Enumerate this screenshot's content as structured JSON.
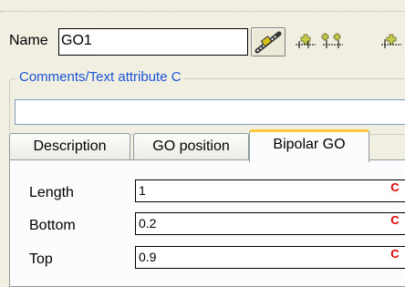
{
  "header": {
    "name_label": "Name",
    "name_value": "GO1"
  },
  "toolbar": {
    "pick_icon": "connector-pick-icon",
    "icons": [
      "insert-before-icon",
      "insert-both-icon",
      "insert-after-icon"
    ]
  },
  "comments": {
    "legend": "Comments/Text attribute C",
    "value": ""
  },
  "tabs": [
    {
      "label": "Description"
    },
    {
      "label": "GO position"
    },
    {
      "label": "Bipolar GO"
    }
  ],
  "active_tab": "Bipolar GO",
  "fields": [
    {
      "label": "Length",
      "value": "1",
      "flag": "C"
    },
    {
      "label": "Bottom",
      "value": "0.2",
      "flag": "C"
    },
    {
      "label": "Top",
      "value": "0.9",
      "flag": "C"
    }
  ],
  "colors": {
    "legend": "#1a55d6",
    "flag": "#e00000",
    "active_tab_accent": "#ffc83c"
  }
}
